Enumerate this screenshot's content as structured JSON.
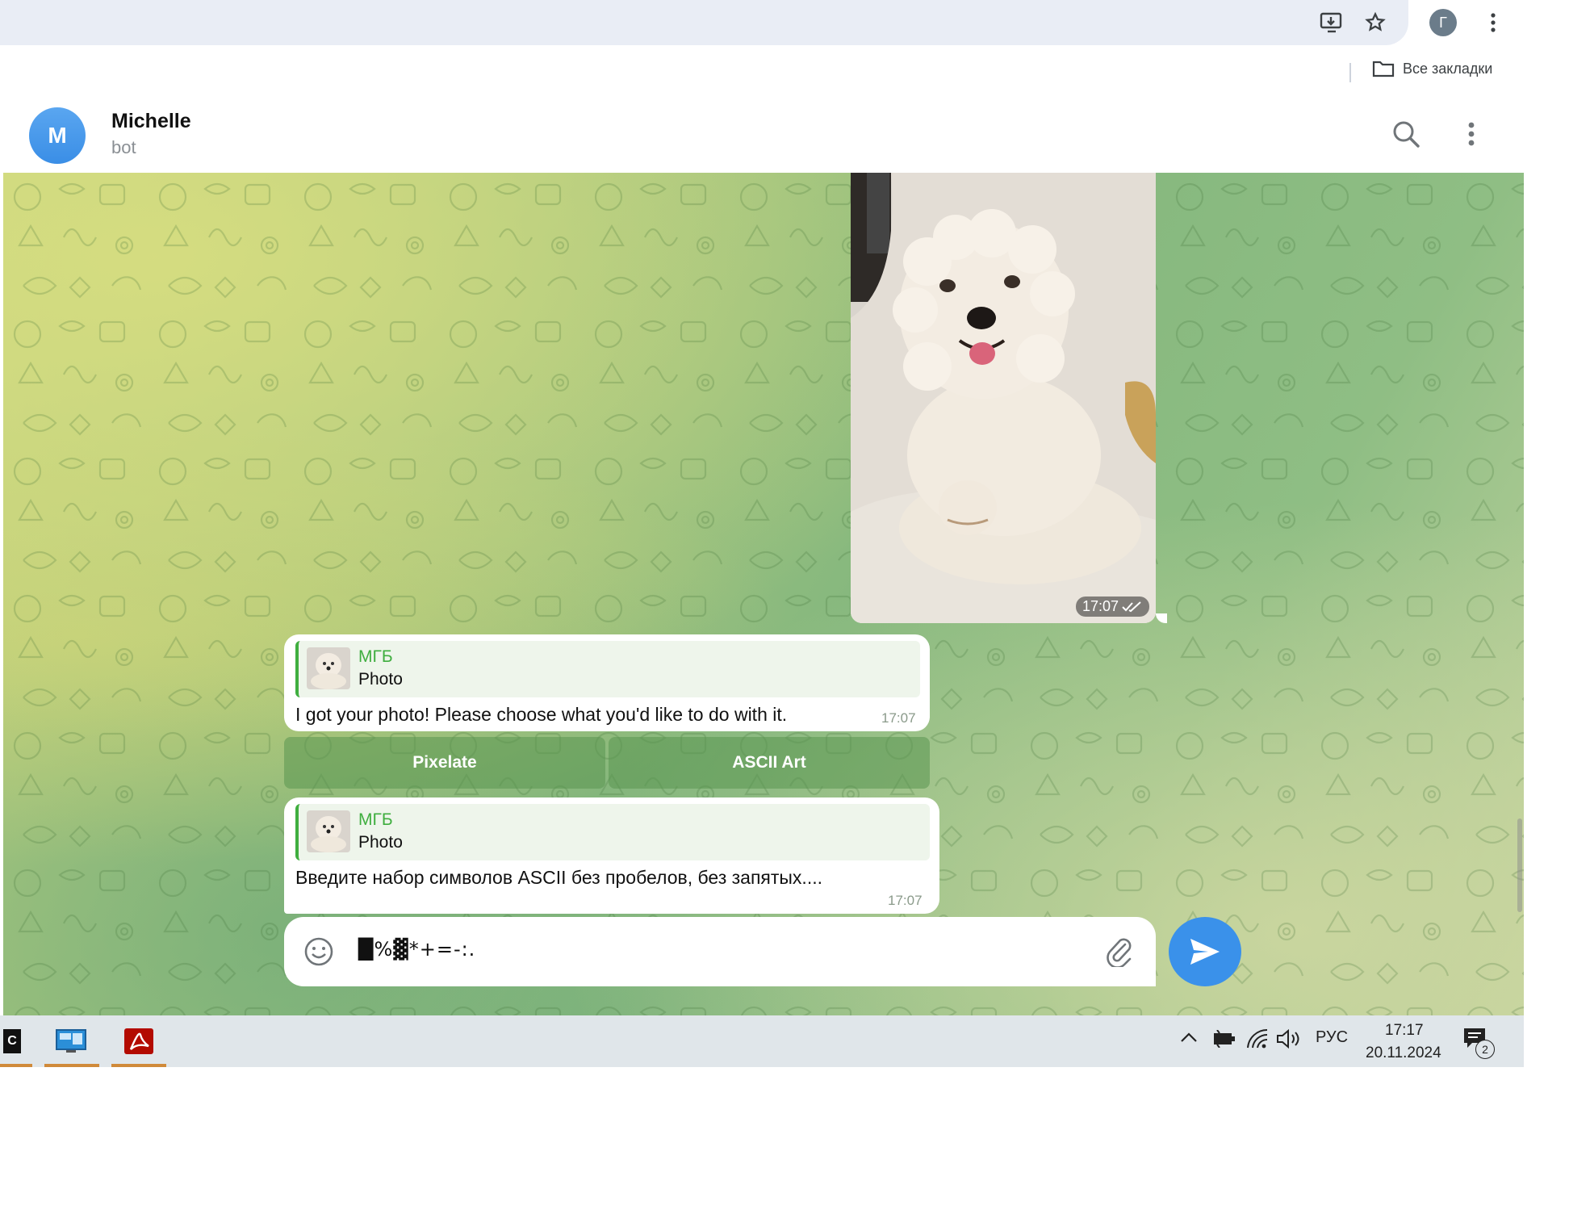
{
  "browser": {
    "bookmarks_label": "Все закладки",
    "profile_initial": "Г"
  },
  "chat": {
    "avatar_letter": "M",
    "name": "Michelle",
    "status": "bot"
  },
  "photo_message": {
    "time": "17:07"
  },
  "messages": [
    {
      "reply_name": "МГБ",
      "reply_text": "Photo",
      "text": "I got your photo! Please choose what you'd like to do with it.",
      "time": "17:07"
    },
    {
      "reply_name": "МГБ",
      "reply_text": "Photo",
      "text": "Введите набор символов ASCII без пробелов, без запятых....",
      "time": "17:07"
    }
  ],
  "keyboard": {
    "buttons": [
      "Pixelate",
      "ASCII Art"
    ]
  },
  "composer": {
    "value": "█%▓*+=-:."
  },
  "taskbar": {
    "language": "РУС",
    "time": "17:17",
    "date": "20.11.2024",
    "notification_count": "2"
  }
}
